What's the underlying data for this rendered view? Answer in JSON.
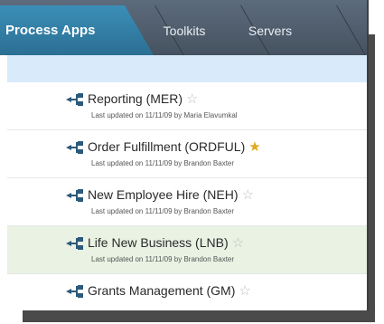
{
  "tabs": [
    {
      "label": "Process Apps",
      "active": true
    },
    {
      "label": "Toolkits",
      "active": false
    },
    {
      "label": "Servers",
      "active": false
    }
  ],
  "apps": [
    {
      "title": "Reporting (MER)",
      "meta": "Last updated on 11/11/09 by Maria Elavumkal",
      "favorite": false,
      "highlighted": false
    },
    {
      "title": "Order Fulfillment (ORDFUL)",
      "meta": "Last updated on 11/11/09 by Brandon Baxter",
      "favorite": true,
      "highlighted": false
    },
    {
      "title": "New Employee Hire (NEH)",
      "meta": "Last updated on 11/11/09 by Brandon Baxter",
      "favorite": false,
      "highlighted": false
    },
    {
      "title": "Life New Business (LNB)",
      "meta": "Last updated on 11/11/09 by Brandon Baxter",
      "favorite": false,
      "highlighted": true
    },
    {
      "title": "Grants Management (GM)",
      "meta": "",
      "favorite": false,
      "highlighted": false
    }
  ],
  "colors": {
    "tab_active": "#2b6f93",
    "tab_bar": "#4f5c6b",
    "favorite_star": "#e0a720",
    "highlight_row": "#e9f2e3"
  }
}
